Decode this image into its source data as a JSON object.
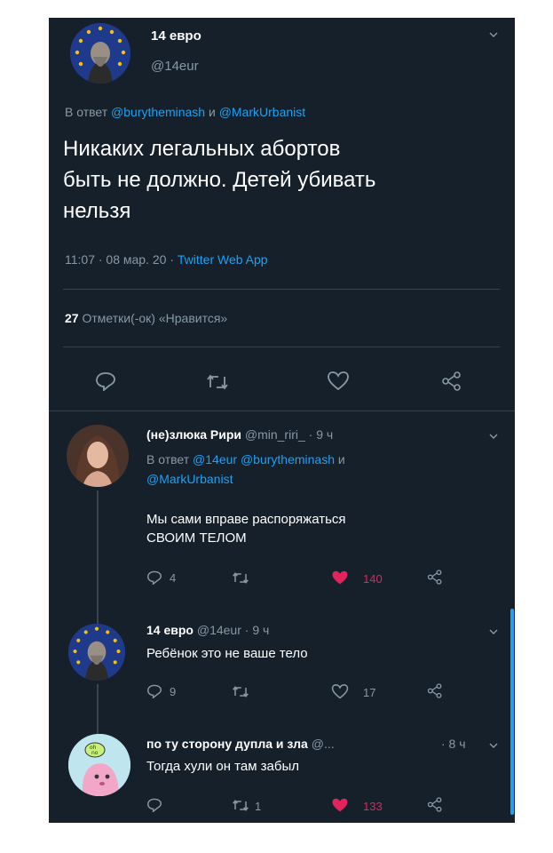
{
  "main_tweet": {
    "author_name": "14 евро",
    "author_handle": "@14eur",
    "reply_prefix": "В ответ",
    "reply_to_1": "@burytheminash",
    "reply_conj": "и",
    "reply_to_2": "@MarkUrbanist",
    "text_line1": "Никаких легальных абортов",
    "text_line2": "быть не должно. Детей убивать",
    "text_line3": "нельзя",
    "timestamp": "11:07 · 08 мар. 20 ·",
    "source": "Twitter Web App",
    "likes_count": "27",
    "likes_label": "Отметки(-ок) «Нравится»"
  },
  "replies": [
    {
      "author_name": "(не)злюка Рири",
      "author_handle": "@min_riri_",
      "time": "· 9 ч",
      "reply_prefix": "В ответ",
      "reply_to_1": "@14eur",
      "reply_to_2": "@burytheminash",
      "reply_conj": "и",
      "reply_to_3": "@MarkUrbanist",
      "text_line1": "Мы сами вправе распоряжаться",
      "text_line2": "СВОИМ ТЕЛОМ",
      "reply_count": "4",
      "like_count": "140"
    },
    {
      "author_name": "14 евро",
      "author_handle": "@14eur",
      "time": "· 9 ч",
      "text_line1": "Ребёнок это не ваше тело",
      "reply_count": "9",
      "like_count": "17"
    },
    {
      "author_name": "по ту сторону дупла и зла",
      "author_handle": "@...",
      "time": "· 8 ч",
      "text_line1": "Тогда хули он там забыл",
      "retweet_count": "1",
      "like_count": "133"
    }
  ],
  "colors": {
    "background": "#15202b",
    "accent": "#1da1f2",
    "muted": "#8899a6",
    "like": "#e0245e",
    "divider": "#38444d"
  }
}
